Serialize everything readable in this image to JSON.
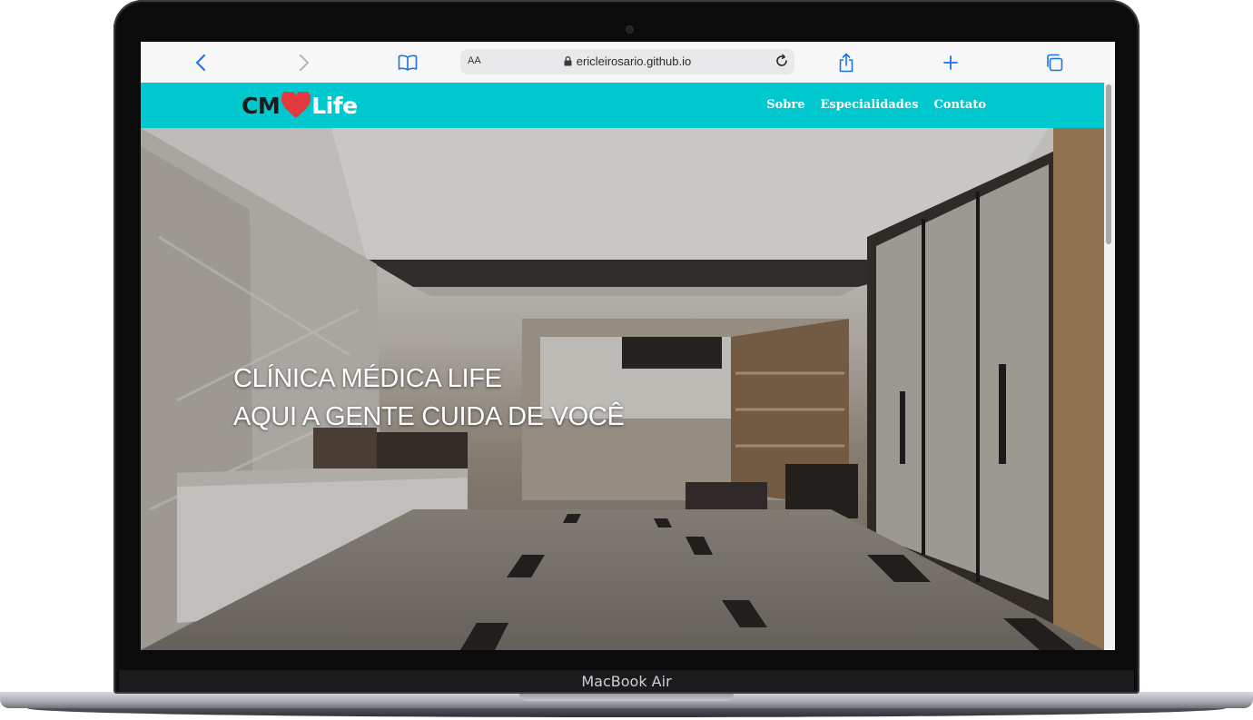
{
  "device": {
    "brand": "MacBook Air"
  },
  "browser": {
    "url": "ericleirosario.github.io",
    "text_size_label": "AA"
  },
  "site": {
    "logo": {
      "prefix": "CM",
      "suffix": "Life"
    },
    "nav": [
      {
        "label": "Sobre"
      },
      {
        "label": "Especialidades"
      },
      {
        "label": "Contato"
      }
    ],
    "hero": {
      "line1": "CLÍNICA MÉDICA LIFE",
      "line2": "AQUI A GENTE CUIDA DE VOCÊ"
    }
  },
  "colors": {
    "navbar": "#00c8cf",
    "heart": "#e23a3f",
    "safari_accent": "#1a73e8"
  }
}
